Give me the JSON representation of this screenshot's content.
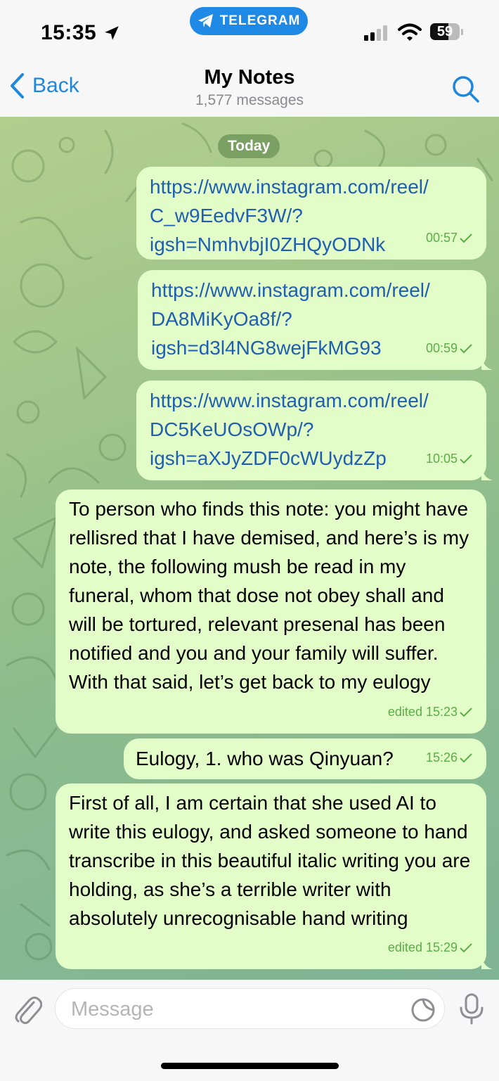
{
  "status_bar": {
    "time": "15:35",
    "app_pill": "TELEGRAM",
    "battery": "59"
  },
  "nav": {
    "back_label": "Back",
    "title": "My Notes",
    "subtitle": "1,577 messages"
  },
  "chat": {
    "date_label": "Today",
    "messages": [
      {
        "text": "https://www.instagram.com/reel/C_w9EedvF3W/?igsh=NmhvbjI0ZHQyODNk",
        "lines": [
          "https://www.instagram.com/reel/",
          "C_w9EedvF3W/?",
          "igsh=NmhvbjI0ZHQyODNk"
        ],
        "time": "00:57",
        "is_link": true
      },
      {
        "text": "https://www.instagram.com/reel/DA8MiKyOa8f/?igsh=d3l4NG8wejFkMG93",
        "lines": [
          "https://www.instagram.com/reel/",
          "DA8MiKyOa8f/?",
          "igsh=d3l4NG8wejFkMG93"
        ],
        "time": "00:59",
        "is_link": true
      },
      {
        "text": "https://www.instagram.com/reel/DC5KeUOsOWp/?igsh=aXJyZDF0cWUydzZp",
        "lines": [
          "https://www.instagram.com/reel/",
          "DC5KeUOsOWp/?",
          "igsh=aXJyZDF0cWUydzZp"
        ],
        "time": "10:05",
        "is_link": true
      },
      {
        "text": "To person who finds this note: you might have rellisred that I have demised, and here’s is my note, the following mush be read in my funeral, whom that dose not obey shall and will be tortured, relevant presenal has been notified and you and your family will suffer. With that said, let’s get back to my eulogy",
        "time": "edited 15:23",
        "is_link": false
      },
      {
        "text": "Eulogy, 1. who was Qinyuan?",
        "time": "15:26",
        "is_link": false
      },
      {
        "text": "First of all, I am certain that she used AI to write this eulogy, and asked someone to hand transcribe in this beautiful italic writing you are holding, as she’s a terrible writer with absolutely unrecognisable hand writing",
        "time": "edited 15:29",
        "is_link": false
      }
    ]
  },
  "input": {
    "placeholder": "Message"
  },
  "colors": {
    "accent": "#1e86dd",
    "bubble_out": "#e2fdc8",
    "link": "#1f5eb0",
    "meta_green": "#5bad45",
    "pill_blue": "#1e8ae6"
  },
  "icons": [
    "location-arrow-icon",
    "telegram-plane-icon",
    "signal-bars-icon",
    "wifi-icon",
    "battery-icon",
    "chevron-left-icon",
    "search-icon",
    "check-icon",
    "paperclip-icon",
    "sticker-icon",
    "microphone-icon"
  ]
}
